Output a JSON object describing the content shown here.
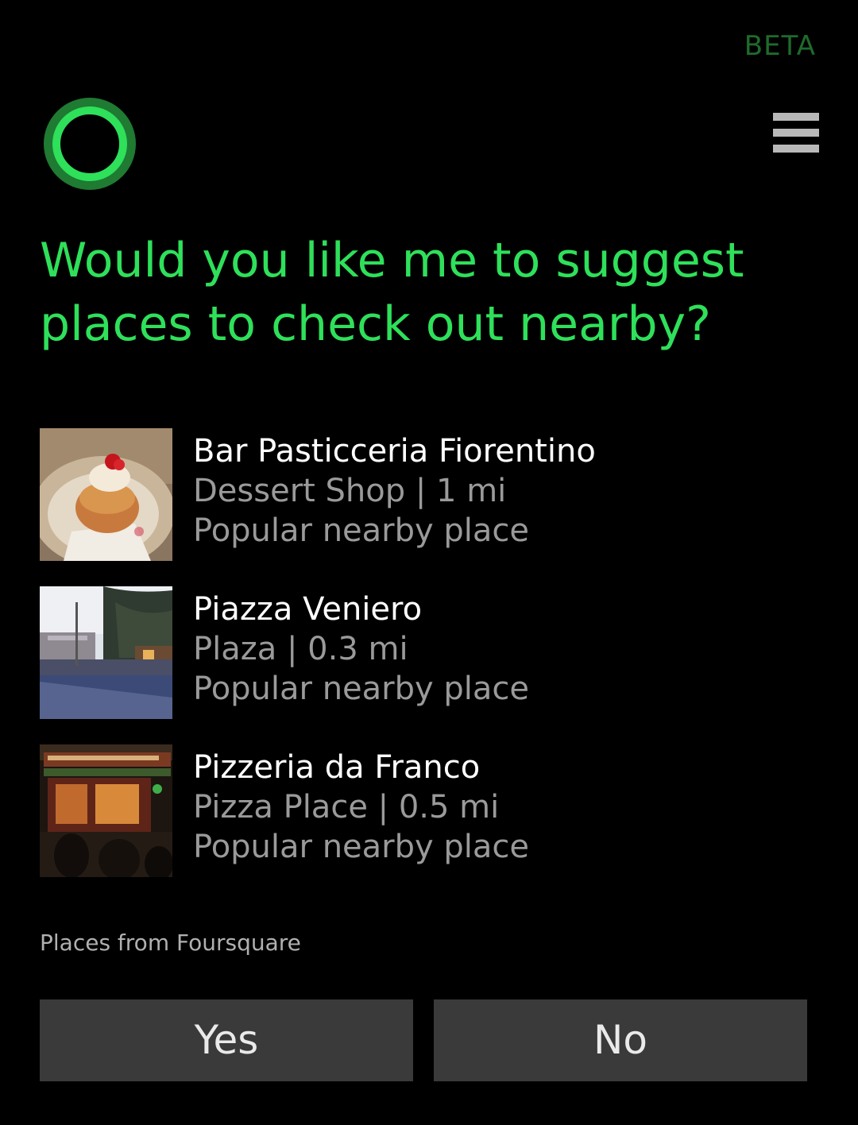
{
  "header": {
    "beta_label": "BETA",
    "logo_icon": "cortana-circle-icon",
    "menu_icon": "hamburger-menu-icon"
  },
  "question": "Would you like me to suggest places to check out nearby?",
  "places": [
    {
      "name": "Bar Pasticceria Fiorentino",
      "category_distance": "Dessert Shop | 1 mi",
      "note": "Popular nearby place",
      "thumbnail": "pastry-photo"
    },
    {
      "name": "Piazza Veniero",
      "category_distance": "Plaza | 0.3 mi",
      "note": "Popular nearby place",
      "thumbnail": "plaza-photo"
    },
    {
      "name": "Pizzeria da Franco",
      "category_distance": "Pizza Place | 0.5 mi",
      "note": "Popular nearby place",
      "thumbnail": "pizzeria-photo"
    }
  ],
  "source": "Places from Foursquare",
  "buttons": {
    "yes_label": "Yes",
    "no_label": "No"
  },
  "colors": {
    "accent": "#2ee05a",
    "beta": "#1e6b2c",
    "button_bg": "#3a3a3a"
  }
}
